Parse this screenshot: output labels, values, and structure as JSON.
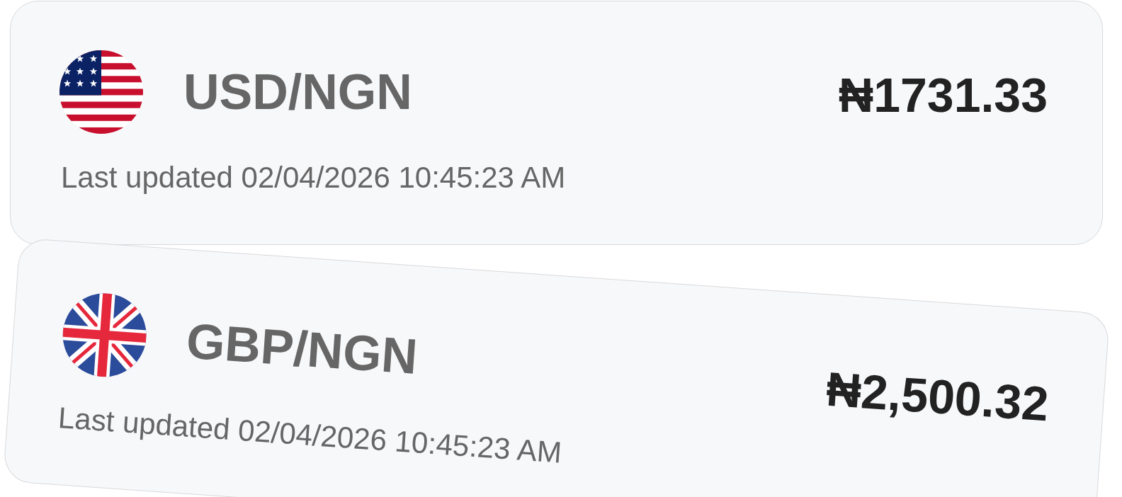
{
  "cards": [
    {
      "kind": "us",
      "pair": "USD/NGN",
      "rate": "₦1731.33",
      "updated": "Last updated 02/04/2026 10:45:23 AM",
      "dragging": false
    },
    {
      "kind": "uk",
      "pair": "GBP/NGN",
      "rate": "₦2,500.32",
      "updated": "Last updated 02/04/2026 10:45:23 AM",
      "dragging": true
    }
  ]
}
